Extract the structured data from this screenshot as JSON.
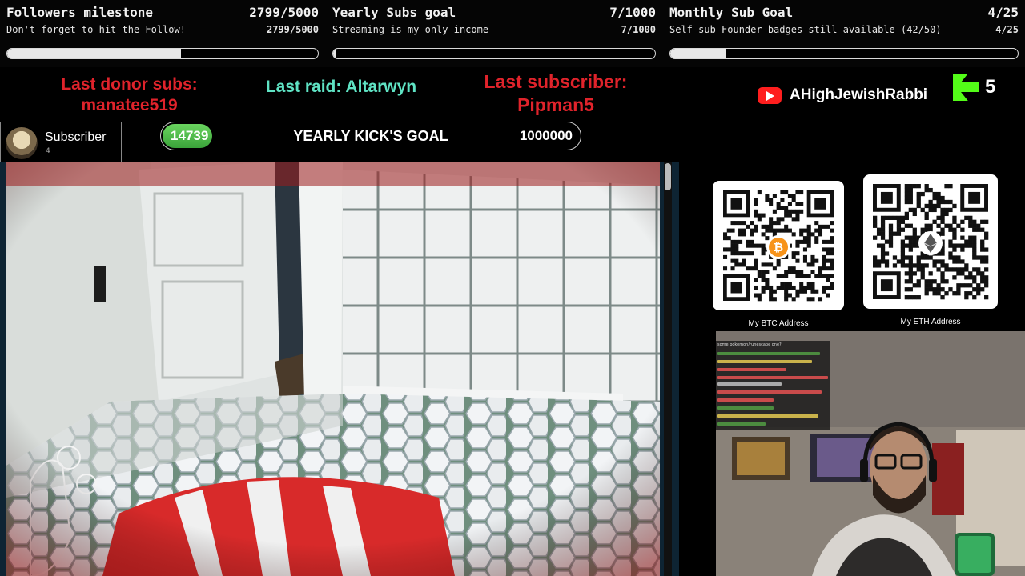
{
  "goals": [
    {
      "title": "Followers milestone",
      "count": "2799/5000",
      "subtitle": "Don't forget to hit the Follow!",
      "count_small": "2799/5000",
      "progress": 0.5598
    },
    {
      "title": "Yearly Subs goal",
      "count": "7/1000",
      "subtitle": "Streaming is my only income",
      "count_small": "7/1000",
      "progress": 0.007
    },
    {
      "title": "Monthly Sub Goal",
      "count": "4/25",
      "subtitle": "Self sub Founder badges still available (42/50)",
      "count_small": "4/25",
      "progress": 0.16
    }
  ],
  "alerts": {
    "donor_label": "Last donor subs:",
    "donor_name": "manatee519",
    "raid": "Last raid: Altarwyn",
    "subscriber_label": "Last subscriber:",
    "subscriber_name": "Pipman5"
  },
  "youtube": {
    "channel": "AHighJewishRabbi",
    "icon": "youtube-icon"
  },
  "kick": {
    "count": "5",
    "icon": "kick-icon"
  },
  "subscriber_card": {
    "label": "Subscriber",
    "number": "4"
  },
  "kick_goal": {
    "current": "14739",
    "title": "YEARLY KICK'S GOAL",
    "target": "1000000",
    "progress": 0.014739
  },
  "crypto": [
    {
      "caption": "My BTC Address",
      "icon": "bitcoin-icon"
    },
    {
      "caption": "My ETH Address",
      "icon": "ethereum-icon"
    }
  ],
  "chat_overlay": {
    "first_line": "some pokemon/runescape one?"
  },
  "colors": {
    "alert_red": "#e0232b",
    "raid_teal": "#5fe3c4",
    "kick_green": "#53fc18",
    "youtube_red": "#ff1e1e",
    "bitcoin_orange": "#f7931a"
  }
}
